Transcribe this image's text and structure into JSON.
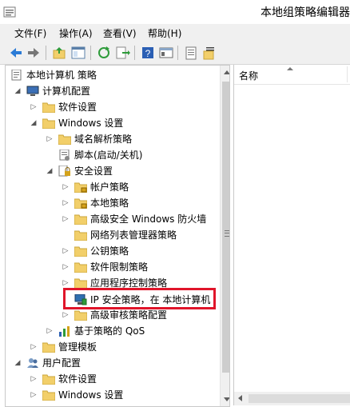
{
  "window": {
    "title": "本地组策略编辑器"
  },
  "menu": [
    {
      "label": "文件(F)"
    },
    {
      "label": "操作(A)"
    },
    {
      "label": "查看(V)"
    },
    {
      "label": "帮助(H)"
    }
  ],
  "toolbar": {
    "buttons": [
      {
        "icon": "back-icon"
      },
      {
        "icon": "forward-icon"
      },
      {
        "icon": "up-folder-icon"
      },
      {
        "icon": "show-hide-tree-icon"
      },
      {
        "icon": "refresh-icon"
      },
      {
        "icon": "export-list-icon"
      },
      {
        "icon": "help-icon"
      },
      {
        "icon": "properties-icon"
      },
      {
        "icon": "filter-icon"
      },
      {
        "icon": "new-item-icon"
      }
    ]
  },
  "tree": {
    "items": [
      {
        "label": "本地计算机 策略",
        "expander": "none",
        "icon": "computer-policy-icon"
      },
      {
        "label": "计算机配置",
        "expander": "expanded",
        "icon": "computer-icon"
      },
      {
        "label": "软件设置",
        "expander": "collapsed",
        "icon": "folder-icon"
      },
      {
        "label": "Windows 设置",
        "expander": "expanded",
        "icon": "folder-icon"
      },
      {
        "label": "域名解析策略",
        "expander": "collapsed",
        "icon": "folder-icon"
      },
      {
        "label": "脚本(启动/关机)",
        "expander": "none",
        "icon": "script-icon"
      },
      {
        "label": "安全设置",
        "expander": "expanded",
        "icon": "security-icon"
      },
      {
        "label": "帐户策略",
        "expander": "collapsed",
        "icon": "folder-lock-icon"
      },
      {
        "label": "本地策略",
        "expander": "collapsed",
        "icon": "folder-lock-icon"
      },
      {
        "label": "高级安全 Windows 防火墙",
        "expander": "collapsed",
        "icon": "folder-icon"
      },
      {
        "label": "网络列表管理器策略",
        "expander": "none",
        "icon": "folder-icon"
      },
      {
        "label": "公钥策略",
        "expander": "collapsed",
        "icon": "folder-icon"
      },
      {
        "label": "软件限制策略",
        "expander": "collapsed",
        "icon": "folder-icon"
      },
      {
        "label": "应用程序控制策略",
        "expander": "collapsed",
        "icon": "folder-icon"
      },
      {
        "label": "IP 安全策略，在 本地计算机",
        "expander": "none",
        "icon": "ip-security-icon"
      },
      {
        "label": "高级审核策略配置",
        "expander": "collapsed",
        "icon": "folder-icon"
      },
      {
        "label": "基于策略的 QoS",
        "expander": "collapsed",
        "icon": "qos-chart-icon"
      },
      {
        "label": "管理模板",
        "expander": "collapsed",
        "icon": "folder-icon"
      },
      {
        "label": "用户配置",
        "expander": "expanded",
        "icon": "user-icon"
      },
      {
        "label": "软件设置",
        "expander": "collapsed",
        "icon": "folder-icon"
      },
      {
        "label": "Windows 设置",
        "expander": "collapsed",
        "icon": "folder-icon"
      }
    ]
  },
  "list": {
    "columns": [
      {
        "label": "名称"
      }
    ]
  },
  "colors": {
    "highlight_border": "#e0152a",
    "folder": "#f2cf6a"
  }
}
